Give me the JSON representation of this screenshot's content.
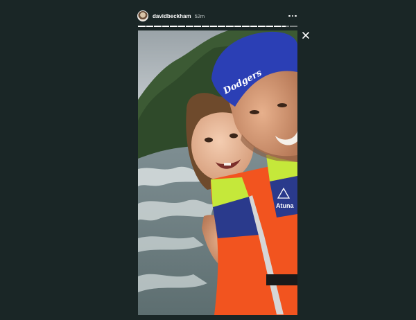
{
  "header": {
    "username": "davidbeckham",
    "timestamp": "52m"
  },
  "icons": {
    "avatar": "profile-avatar",
    "more": "more-options-icon",
    "close": "close-icon"
  },
  "progress": {
    "segments": 20,
    "active_segment": 18,
    "active_fraction": 0.5
  },
  "media": {
    "cap_text": "Dodgers",
    "vest_text": "Atuna"
  },
  "colors": {
    "background": "#1a2626",
    "cap": "#2b3fb5",
    "vest_orange": "#f2541f",
    "vest_yellow": "#c5e83a",
    "vest_navy": "#2a3a8c"
  }
}
